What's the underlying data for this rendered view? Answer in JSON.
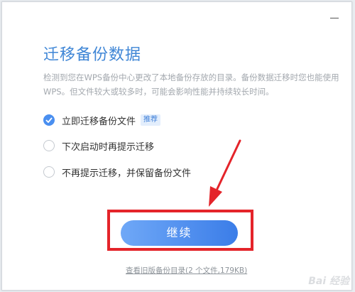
{
  "dialog": {
    "title": "迁移备份数据",
    "description": "检测到您在WPS备份中心更改了本地备份存放的目录。备份数据迁移时您也能使用WPS。但文件较大或较多时，可能会影响性能并持续较长时间。",
    "minimize_icon": "minimize-icon"
  },
  "options": [
    {
      "label": "立即迁移备份文件",
      "checked": true,
      "tag": "推荐"
    },
    {
      "label": "下次启动时再提示迁移",
      "checked": false
    },
    {
      "label": "不再提示迁移，并保留备份文件",
      "checked": false
    }
  ],
  "continue_button": {
    "label": "继续",
    "color_start": "#6fa8f7",
    "color_end": "#3b7de8"
  },
  "old_directory_link": "查看旧版备份目录(2 个文件,179KB)",
  "annotation": {
    "box_color": "#e4242a",
    "arrow_color": "#e4242a"
  },
  "watermark": {
    "text": "Bai 经验"
  }
}
